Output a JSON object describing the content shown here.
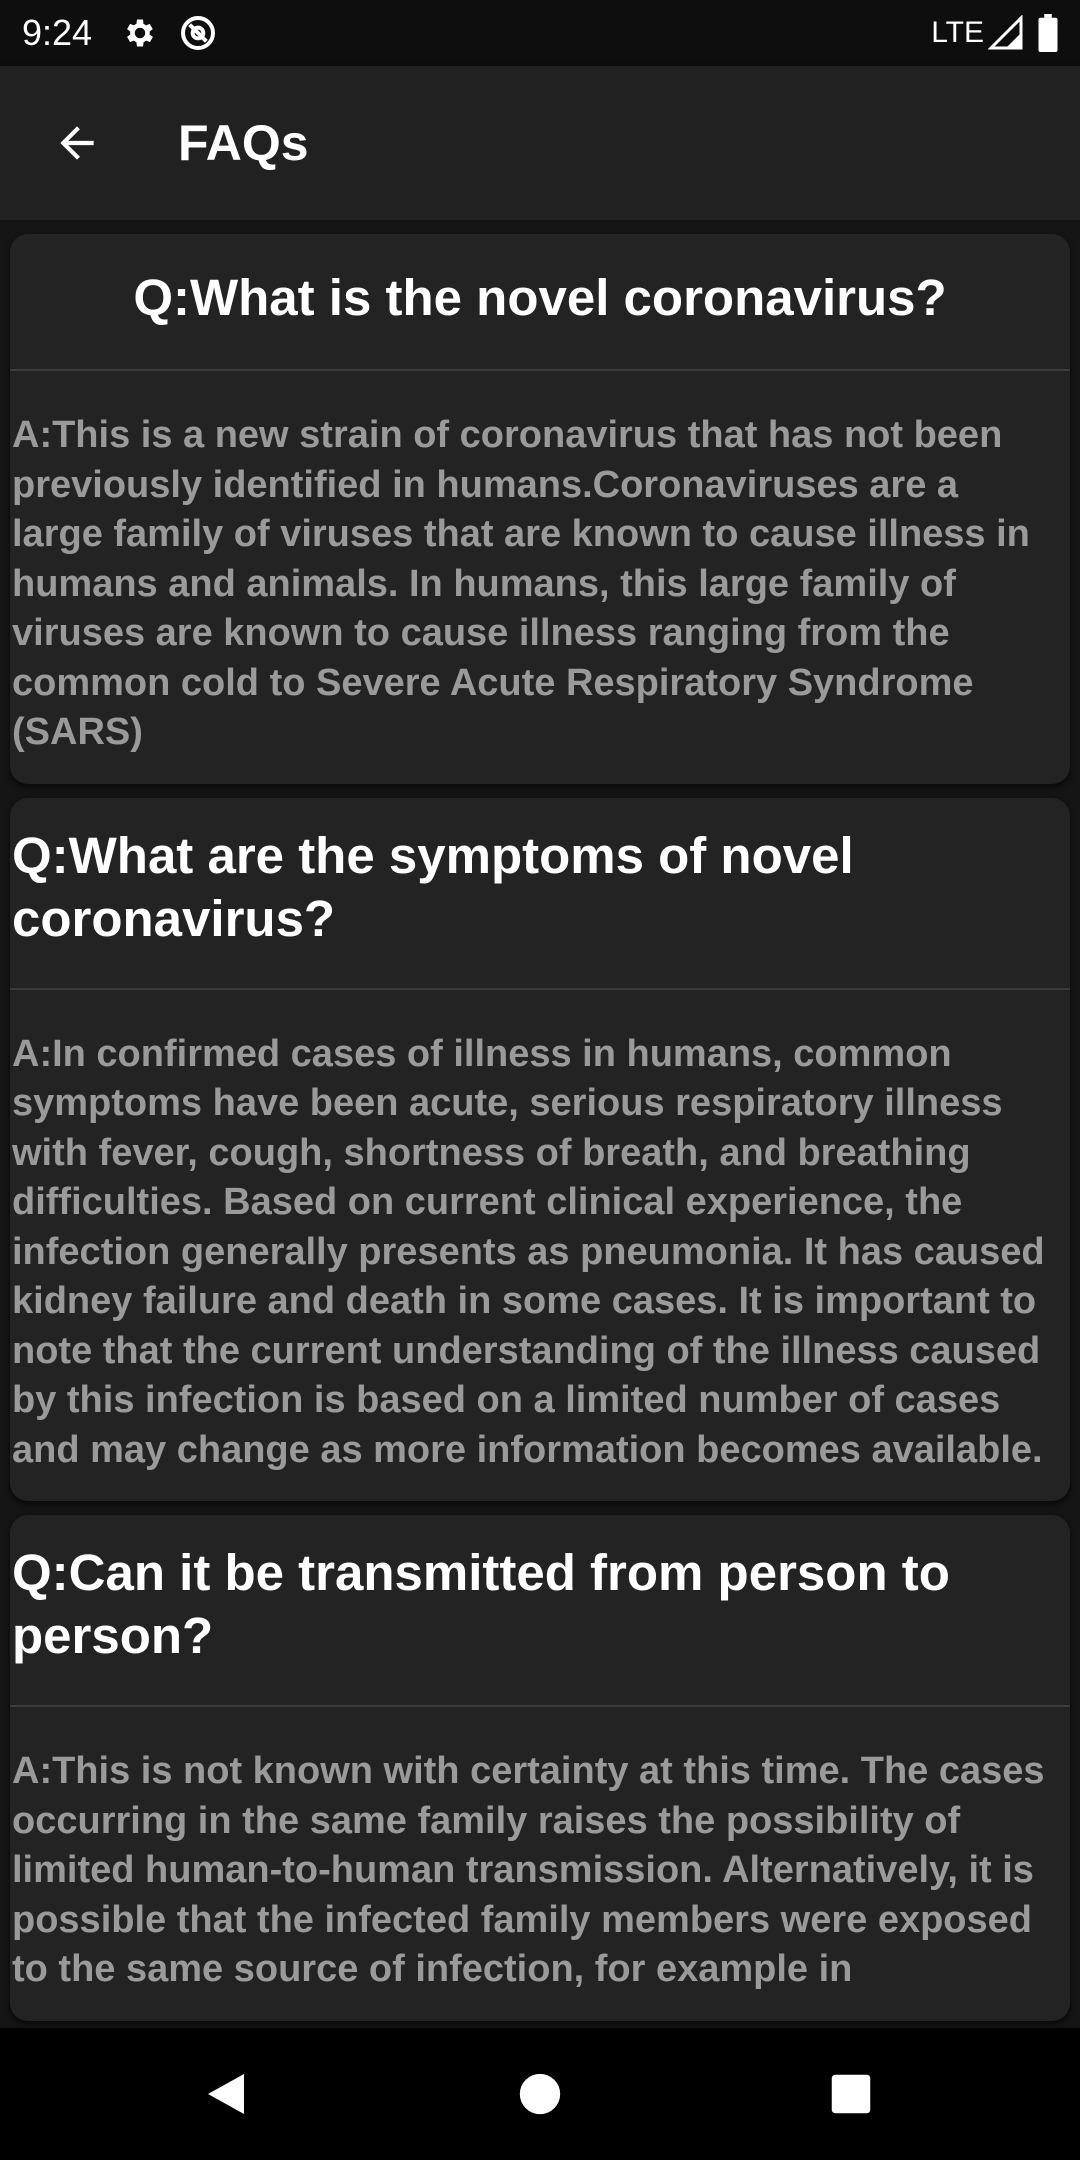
{
  "status_bar": {
    "time": "9:24",
    "network": "LTE",
    "icons": [
      "gear-icon",
      "at-sign-icon",
      "signal-icon",
      "battery-icon"
    ]
  },
  "app_bar": {
    "title": "FAQs",
    "back_icon": "arrow-left-icon"
  },
  "faqs": [
    {
      "question": "Q:What is the novel coronavirus?",
      "answer": "A:This is a new strain of coronavirus that has not been previously identified in humans.Coronaviruses are a large family of viruses that are known to cause illness in humans and animals. In humans, this large family of viruses are known to cause illness ranging from the common cold to Severe Acute Respiratory Syndrome (SARS)"
    },
    {
      "question": "Q:What are the symptoms of novel coronavirus?",
      "answer": "A:In confirmed cases of illness in humans, common symptoms have been acute, serious respiratory illness with fever, cough, shortness of breath, and breathing difficulties. Based on current clinical experience, the infection generally presents as pneumonia. It has caused kidney failure and death in some cases. It is important to note that the current understanding of the illness caused by this infection is based on a limited number of cases and may change as more information becomes available."
    },
    {
      "question": "Q:Can it be transmitted from person to person?",
      "answer": "A:This is not known with certainty at this time. The cases occurring in the same family raises the possibility of limited human-to-human transmission. Alternatively, it is possible that the infected family members were exposed to the same source of infection, for example in"
    }
  ],
  "colors": {
    "background": "#141414",
    "card": "#232323",
    "app_bar": "#212121",
    "question_text": "#ffffff",
    "answer_text": "#9a9a9a",
    "divider": "#3b3b3b"
  },
  "nav_bar": {
    "icons": [
      "back-triangle-icon",
      "home-circle-icon",
      "recents-square-icon"
    ]
  }
}
